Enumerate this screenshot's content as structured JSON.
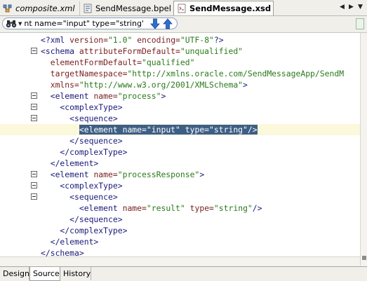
{
  "tabs": [
    {
      "label": "composite.xml",
      "icon": "composite-file-icon",
      "active": false
    },
    {
      "label": "SendMessage.bpel",
      "icon": "bpel-file-icon",
      "active": false
    },
    {
      "label": "SendMessage.xsd",
      "icon": "xsd-file-icon",
      "active": true
    }
  ],
  "search": {
    "value": "nt name=\"input\" type=\"string\"/>",
    "icon": "binoculars-icon"
  },
  "code_lines": [
    {
      "fold": false,
      "parts": [
        {
          "t": "<?xml ",
          "c": "c-tag"
        },
        {
          "t": "version=",
          "c": "c-attr"
        },
        {
          "t": "\"1.0\" ",
          "c": "c-str"
        },
        {
          "t": "encoding=",
          "c": "c-attr"
        },
        {
          "t": "\"UTF-8\"",
          "c": "c-str"
        },
        {
          "t": "?>",
          "c": "c-tag"
        }
      ]
    },
    {
      "fold": true,
      "parts": [
        {
          "t": "<schema ",
          "c": "c-tag"
        },
        {
          "t": "attributeFormDefault=",
          "c": "c-attr"
        },
        {
          "t": "\"unqualified\"",
          "c": "c-str"
        }
      ]
    },
    {
      "fold": false,
      "parts": [
        {
          "t": "  elementFormDefault=",
          "c": "c-attr"
        },
        {
          "t": "\"qualified\"",
          "c": "c-str"
        }
      ]
    },
    {
      "fold": false,
      "parts": [
        {
          "t": "  targetNamespace=",
          "c": "c-attr"
        },
        {
          "t": "\"http://xmlns.oracle.com/SendMessageApp/SendM",
          "c": "c-str"
        }
      ]
    },
    {
      "fold": false,
      "parts": [
        {
          "t": "  xmlns=",
          "c": "c-attr"
        },
        {
          "t": "\"http://www.w3.org/2001/XMLSchema\"",
          "c": "c-str"
        },
        {
          "t": ">",
          "c": "c-tag"
        }
      ]
    },
    {
      "fold": true,
      "parts": [
        {
          "t": "  <element ",
          "c": "c-tag"
        },
        {
          "t": "name=",
          "c": "c-attr"
        },
        {
          "t": "\"process\"",
          "c": "c-str"
        },
        {
          "t": ">",
          "c": "c-tag"
        }
      ]
    },
    {
      "fold": true,
      "parts": [
        {
          "t": "    <complexType>",
          "c": "c-tag"
        }
      ]
    },
    {
      "fold": true,
      "parts": [
        {
          "t": "      <sequence>",
          "c": "c-tag"
        }
      ]
    },
    {
      "fold": false,
      "hl": true,
      "parts": [
        {
          "t": "        ",
          "c": ""
        },
        {
          "t": "<element name=\"input\" type=\"string\"/>",
          "c": "sel"
        }
      ]
    },
    {
      "fold": false,
      "parts": [
        {
          "t": "      </sequence>",
          "c": "c-tag"
        }
      ]
    },
    {
      "fold": false,
      "parts": [
        {
          "t": "    </complexType>",
          "c": "c-tag"
        }
      ]
    },
    {
      "fold": false,
      "parts": [
        {
          "t": "  </element>",
          "c": "c-tag"
        }
      ]
    },
    {
      "fold": true,
      "parts": [
        {
          "t": "  <element ",
          "c": "c-tag"
        },
        {
          "t": "name=",
          "c": "c-attr"
        },
        {
          "t": "\"processResponse\"",
          "c": "c-str"
        },
        {
          "t": ">",
          "c": "c-tag"
        }
      ]
    },
    {
      "fold": true,
      "parts": [
        {
          "t": "    <complexType>",
          "c": "c-tag"
        }
      ]
    },
    {
      "fold": true,
      "parts": [
        {
          "t": "      <sequence>",
          "c": "c-tag"
        }
      ]
    },
    {
      "fold": false,
      "parts": [
        {
          "t": "        <element ",
          "c": "c-tag"
        },
        {
          "t": "name=",
          "c": "c-attr"
        },
        {
          "t": "\"result\" ",
          "c": "c-str"
        },
        {
          "t": "type=",
          "c": "c-attr"
        },
        {
          "t": "\"string\"",
          "c": "c-str"
        },
        {
          "t": "/>",
          "c": "c-tag"
        }
      ]
    },
    {
      "fold": false,
      "parts": [
        {
          "t": "      </sequence>",
          "c": "c-tag"
        }
      ]
    },
    {
      "fold": false,
      "parts": [
        {
          "t": "    </complexType>",
          "c": "c-tag"
        }
      ]
    },
    {
      "fold": false,
      "parts": [
        {
          "t": "  </element>",
          "c": "c-tag"
        }
      ]
    },
    {
      "fold": false,
      "parts": [
        {
          "t": "</schema>",
          "c": "c-tag"
        }
      ]
    }
  ],
  "bottom_tabs": [
    {
      "label": "Design",
      "active": false
    },
    {
      "label": "Source",
      "active": true
    },
    {
      "label": "History",
      "active": false
    }
  ],
  "colors": {
    "selection": "#3e5f85",
    "current_line": "#fbf8dc",
    "tag": "#1a1a7a",
    "attribute": "#7a1f1f",
    "string": "#2a7a1a"
  }
}
